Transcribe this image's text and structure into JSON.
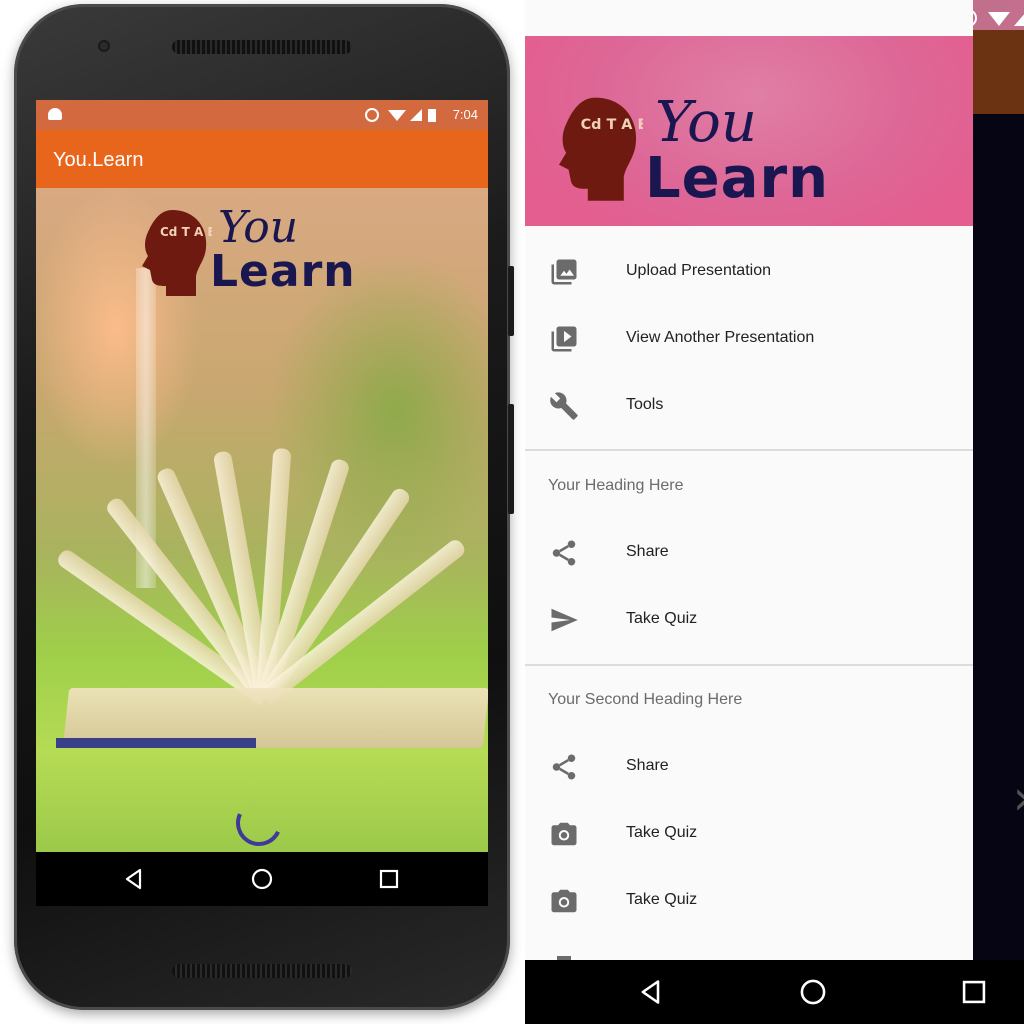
{
  "left_phone": {
    "status_time": "7:04",
    "app_title": "You.Learn",
    "logo": {
      "you": "You",
      "learn": "Learn",
      "head_letters": "Cd T A B"
    }
  },
  "drawer": {
    "logo": {
      "you": "You",
      "learn": "Learn",
      "head_letters": "Cd T A B"
    },
    "items": [
      {
        "label": "Upload Presentation",
        "icon": "photo-library-icon"
      },
      {
        "label": "View Another Presentation",
        "icon": "video-library-icon"
      },
      {
        "label": "Tools",
        "icon": "wrench-icon"
      }
    ],
    "section1": {
      "heading": "Your Heading Here",
      "items": [
        {
          "label": "Share",
          "icon": "share-icon"
        },
        {
          "label": "Take Quiz",
          "icon": "send-icon"
        }
      ]
    },
    "section2": {
      "heading": "Your Second Heading Here",
      "items": [
        {
          "label": "Share",
          "icon": "share-icon"
        },
        {
          "label": "Take Quiz",
          "icon": "camera-icon"
        },
        {
          "label": "Take Quiz",
          "icon": "camera-icon"
        }
      ]
    }
  },
  "colors": {
    "app_bar": "#e8661b",
    "status_bar_left": "#d2693f",
    "drawer_header": "#dd6796",
    "logo_text": "#1a1650",
    "logo_head": "#6e1a10",
    "spinner": "#3f3a9a"
  }
}
